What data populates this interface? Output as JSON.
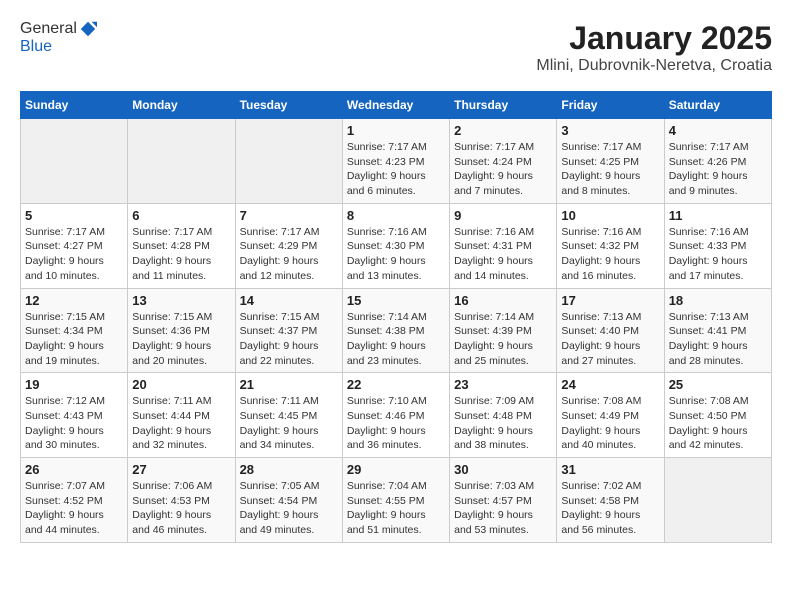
{
  "header": {
    "logo_line1": "General",
    "logo_line2": "Blue",
    "title": "January 2025",
    "subtitle": "Mlini, Dubrovnik-Neretva, Croatia"
  },
  "weekdays": [
    "Sunday",
    "Monday",
    "Tuesday",
    "Wednesday",
    "Thursday",
    "Friday",
    "Saturday"
  ],
  "weeks": [
    [
      {
        "day": "",
        "info": ""
      },
      {
        "day": "",
        "info": ""
      },
      {
        "day": "",
        "info": ""
      },
      {
        "day": "1",
        "info": "Sunrise: 7:17 AM\nSunset: 4:23 PM\nDaylight: 9 hours and 6 minutes."
      },
      {
        "day": "2",
        "info": "Sunrise: 7:17 AM\nSunset: 4:24 PM\nDaylight: 9 hours and 7 minutes."
      },
      {
        "day": "3",
        "info": "Sunrise: 7:17 AM\nSunset: 4:25 PM\nDaylight: 9 hours and 8 minutes."
      },
      {
        "day": "4",
        "info": "Sunrise: 7:17 AM\nSunset: 4:26 PM\nDaylight: 9 hours and 9 minutes."
      }
    ],
    [
      {
        "day": "5",
        "info": "Sunrise: 7:17 AM\nSunset: 4:27 PM\nDaylight: 9 hours and 10 minutes."
      },
      {
        "day": "6",
        "info": "Sunrise: 7:17 AM\nSunset: 4:28 PM\nDaylight: 9 hours and 11 minutes."
      },
      {
        "day": "7",
        "info": "Sunrise: 7:17 AM\nSunset: 4:29 PM\nDaylight: 9 hours and 12 minutes."
      },
      {
        "day": "8",
        "info": "Sunrise: 7:16 AM\nSunset: 4:30 PM\nDaylight: 9 hours and 13 minutes."
      },
      {
        "day": "9",
        "info": "Sunrise: 7:16 AM\nSunset: 4:31 PM\nDaylight: 9 hours and 14 minutes."
      },
      {
        "day": "10",
        "info": "Sunrise: 7:16 AM\nSunset: 4:32 PM\nDaylight: 9 hours and 16 minutes."
      },
      {
        "day": "11",
        "info": "Sunrise: 7:16 AM\nSunset: 4:33 PM\nDaylight: 9 hours and 17 minutes."
      }
    ],
    [
      {
        "day": "12",
        "info": "Sunrise: 7:15 AM\nSunset: 4:34 PM\nDaylight: 9 hours and 19 minutes."
      },
      {
        "day": "13",
        "info": "Sunrise: 7:15 AM\nSunset: 4:36 PM\nDaylight: 9 hours and 20 minutes."
      },
      {
        "day": "14",
        "info": "Sunrise: 7:15 AM\nSunset: 4:37 PM\nDaylight: 9 hours and 22 minutes."
      },
      {
        "day": "15",
        "info": "Sunrise: 7:14 AM\nSunset: 4:38 PM\nDaylight: 9 hours and 23 minutes."
      },
      {
        "day": "16",
        "info": "Sunrise: 7:14 AM\nSunset: 4:39 PM\nDaylight: 9 hours and 25 minutes."
      },
      {
        "day": "17",
        "info": "Sunrise: 7:13 AM\nSunset: 4:40 PM\nDaylight: 9 hours and 27 minutes."
      },
      {
        "day": "18",
        "info": "Sunrise: 7:13 AM\nSunset: 4:41 PM\nDaylight: 9 hours and 28 minutes."
      }
    ],
    [
      {
        "day": "19",
        "info": "Sunrise: 7:12 AM\nSunset: 4:43 PM\nDaylight: 9 hours and 30 minutes."
      },
      {
        "day": "20",
        "info": "Sunrise: 7:11 AM\nSunset: 4:44 PM\nDaylight: 9 hours and 32 minutes."
      },
      {
        "day": "21",
        "info": "Sunrise: 7:11 AM\nSunset: 4:45 PM\nDaylight: 9 hours and 34 minutes."
      },
      {
        "day": "22",
        "info": "Sunrise: 7:10 AM\nSunset: 4:46 PM\nDaylight: 9 hours and 36 minutes."
      },
      {
        "day": "23",
        "info": "Sunrise: 7:09 AM\nSunset: 4:48 PM\nDaylight: 9 hours and 38 minutes."
      },
      {
        "day": "24",
        "info": "Sunrise: 7:08 AM\nSunset: 4:49 PM\nDaylight: 9 hours and 40 minutes."
      },
      {
        "day": "25",
        "info": "Sunrise: 7:08 AM\nSunset: 4:50 PM\nDaylight: 9 hours and 42 minutes."
      }
    ],
    [
      {
        "day": "26",
        "info": "Sunrise: 7:07 AM\nSunset: 4:52 PM\nDaylight: 9 hours and 44 minutes."
      },
      {
        "day": "27",
        "info": "Sunrise: 7:06 AM\nSunset: 4:53 PM\nDaylight: 9 hours and 46 minutes."
      },
      {
        "day": "28",
        "info": "Sunrise: 7:05 AM\nSunset: 4:54 PM\nDaylight: 9 hours and 49 minutes."
      },
      {
        "day": "29",
        "info": "Sunrise: 7:04 AM\nSunset: 4:55 PM\nDaylight: 9 hours and 51 minutes."
      },
      {
        "day": "30",
        "info": "Sunrise: 7:03 AM\nSunset: 4:57 PM\nDaylight: 9 hours and 53 minutes."
      },
      {
        "day": "31",
        "info": "Sunrise: 7:02 AM\nSunset: 4:58 PM\nDaylight: 9 hours and 56 minutes."
      },
      {
        "day": "",
        "info": ""
      }
    ]
  ]
}
